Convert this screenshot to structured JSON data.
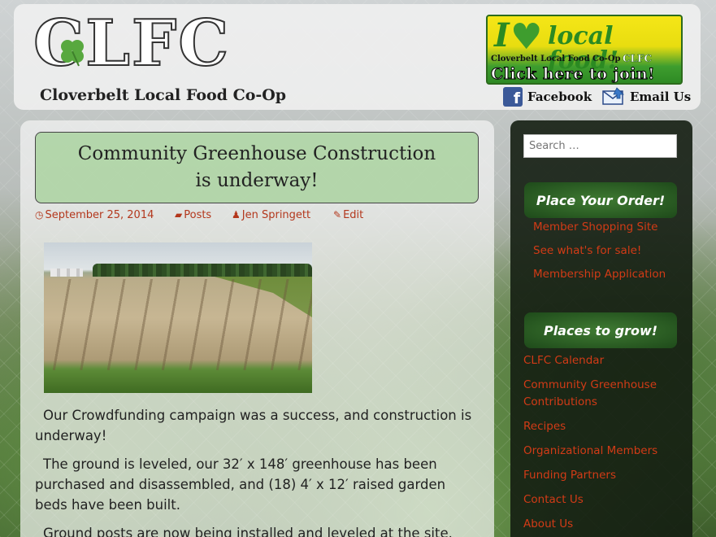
{
  "header": {
    "logo": "CLFC",
    "subtitle": "Cloverbelt Local Food Co-Op",
    "banner": {
      "i_text": "I",
      "local_food": "local food!",
      "coop_name": "Cloverbelt Local Food Co-Op",
      "clfc": "CLFC",
      "join": "Click here to join!"
    },
    "facebook_label": "Facebook",
    "email_label": "Email Us"
  },
  "post": {
    "title": "Community Greenhouse Construction is underway!",
    "date": "September 25, 2014",
    "category": "Posts",
    "author": "Jen Springett",
    "edit": "Edit",
    "paragraphs": [
      "Our Crowdfunding campaign was a success, and construction is underway!",
      "The ground is leveled, our 32′ x 148′ greenhouse has been purchased and disassembled, and (18) 4′ x 12′ raised garden beds have been built.",
      "Ground posts are now being installed and leveled at the site."
    ]
  },
  "sidebar": {
    "search_placeholder": "Search …",
    "order_title": "Place Your Order!",
    "order_links": [
      "Member Shopping Site",
      "See what's for sale!",
      "Membership Application"
    ],
    "places_title": "Places to grow!",
    "places_links": [
      "CLFC Calendar",
      "Community Greenhouse Contributions",
      "Recipes",
      "Organizational Members",
      "Funding Partners",
      "Contact Us",
      "About Us"
    ]
  },
  "colors": {
    "link": "#d23b16",
    "title_box": "#aad2a0",
    "sidebar_bg": "#141e12"
  }
}
